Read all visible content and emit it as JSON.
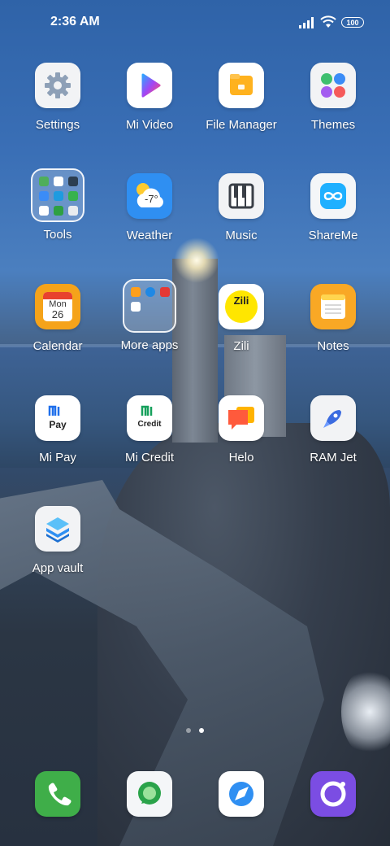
{
  "status_bar": {
    "time": "2:36 AM",
    "battery": "100",
    "icons": [
      "signal-icon",
      "wifi-icon",
      "battery-icon"
    ]
  },
  "apps": {
    "settings": "Settings",
    "mi_video": "Mi Video",
    "file_manager": "File Manager",
    "themes": "Themes",
    "tools": "Tools",
    "weather": "Weather",
    "weather_temp": "-7°",
    "music": "Music",
    "shareme": "ShareMe",
    "calendar": "Calendar",
    "calendar_day": "Mon",
    "calendar_date": "26",
    "more_apps": "More apps",
    "zili": "Zili",
    "zili_icon_text": "Zili",
    "notes": "Notes",
    "mi_pay": "Mi Pay",
    "mi_pay_icon_text": "Pay",
    "mi_credit": "Mi Credit",
    "mi_credit_icon_text": "Credit",
    "helo": "Helo",
    "ram_jet": "RAM Jet",
    "app_vault": "App vault"
  },
  "dock": [
    "phone-icon",
    "messaging-icon",
    "browser-icon",
    "camera-icon"
  ],
  "page_indicator": {
    "pages": 2,
    "current": 2
  },
  "colors": {
    "settings_bg": "#f2f3f5",
    "file_manager_accent": "#ffb21e",
    "weather_bg": "#2f8ff2",
    "calendar_accent": "#f5a31a",
    "notes_accent": "#f9a825",
    "helo_accent": "#ff5a3c",
    "phone_bg": "#3fae49",
    "camera_bg": "#7b4de3"
  }
}
